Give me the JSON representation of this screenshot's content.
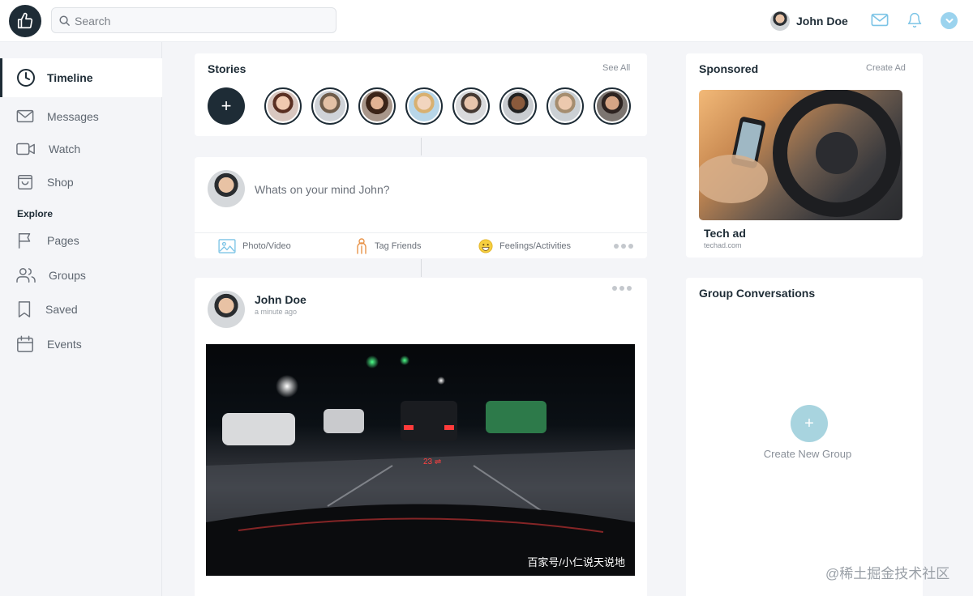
{
  "header": {
    "search": {
      "placeholder": "Search"
    },
    "user": {
      "name": "John Doe"
    },
    "icons": [
      "thumbs-up-icon",
      "search-icon",
      "mail-icon",
      "bell-icon",
      "chevron-down-icon"
    ],
    "accent": "#1e2c36",
    "icon_color": "#7cc4e6"
  },
  "sidebar": {
    "items": [
      {
        "label": "Timeline",
        "icon": "clock-icon",
        "active": true
      },
      {
        "label": "Messages",
        "icon": "mail-icon"
      },
      {
        "label": "Watch",
        "icon": "video-icon"
      },
      {
        "label": "Shop",
        "icon": "shopping-bag-icon"
      },
      {
        "label": "Pages",
        "icon": "flag-icon"
      },
      {
        "label": "Groups",
        "icon": "users-icon"
      },
      {
        "label": "Saved",
        "icon": "bookmark-icon"
      },
      {
        "label": "Events",
        "icon": "calendar-icon"
      }
    ],
    "section_label": "Explore"
  },
  "stories": {
    "title": "Stories",
    "see_all": "See All",
    "add_label": "+",
    "count": 8
  },
  "composer": {
    "placeholder": "Whats on your mind John?",
    "actions": [
      {
        "label": "Photo/Video",
        "icon": "image-icon"
      },
      {
        "label": "Tag Friends",
        "icon": "tag-friends-icon"
      },
      {
        "label": "Feelings/Activities",
        "icon": "smile-icon"
      }
    ]
  },
  "post": {
    "author": "John Doe",
    "time": "a minute ago",
    "media_caption": "百家号/小仁说天说地"
  },
  "sponsored": {
    "title": "Sponsored",
    "create_ad": "Create Ad",
    "ad_name": "Tech ad",
    "ad_url": "techad.com"
  },
  "groups": {
    "title": "Group Conversations",
    "create_icon": "+",
    "create_label": "Create New Group"
  },
  "watermark": "@稀土掘金技术社区"
}
